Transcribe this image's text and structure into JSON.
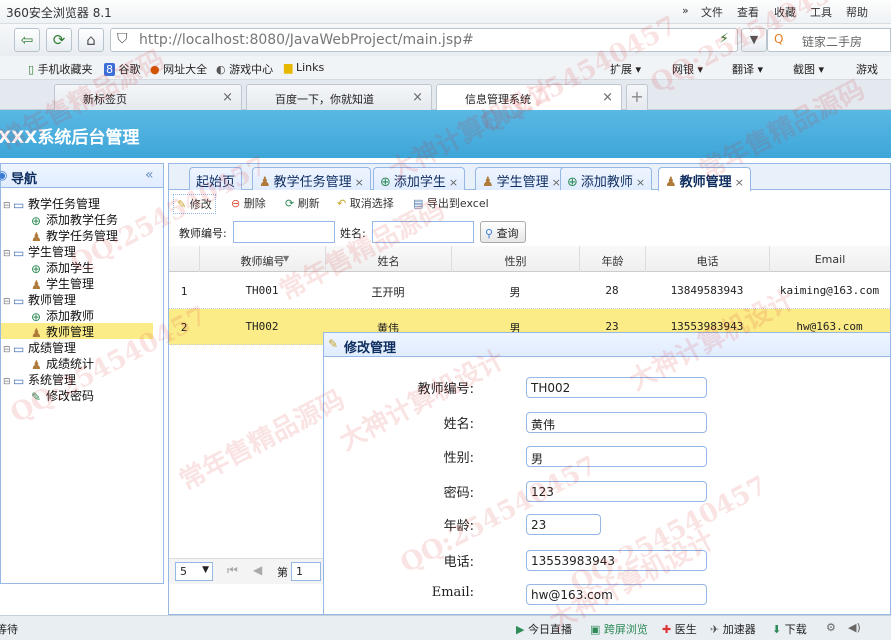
{
  "browser": {
    "title": "360安全浏览器 8.1",
    "menu": [
      "»",
      "文件",
      "查看",
      "收藏",
      "工具",
      "帮助"
    ],
    "url": "http://localhost:8080/JavaWebProject/main.jsp#",
    "search_placeholder": "链家二手房",
    "favorites": [
      "手机收藏夹",
      "谷歌",
      "网址大全",
      "游戏中心",
      "Links"
    ],
    "fav_right": [
      "扩展",
      "网银",
      "翻译",
      "截图",
      "游戏"
    ],
    "tabs": [
      {
        "label": "新标签页"
      },
      {
        "label": "百度一下，你就知道"
      },
      {
        "label": "信息管理系统"
      }
    ],
    "tab_close": "×",
    "new_tab": "+"
  },
  "app": {
    "title": "XXX系统后台管理"
  },
  "sidebar": {
    "title": "导航",
    "collapse": "«",
    "tree": [
      {
        "label": "教学任务管理",
        "level": 0
      },
      {
        "label": "添加教学任务",
        "level": 1,
        "icon": "add"
      },
      {
        "label": "教学任务管理",
        "level": 1,
        "icon": "user"
      },
      {
        "label": "学生管理",
        "level": 0
      },
      {
        "label": "添加学生",
        "level": 1,
        "icon": "add"
      },
      {
        "label": "学生管理",
        "level": 1,
        "icon": "user"
      },
      {
        "label": "教师管理",
        "level": 0
      },
      {
        "label": "添加教师",
        "level": 1,
        "icon": "add"
      },
      {
        "label": "教师管理",
        "level": 1,
        "icon": "user",
        "selected": true
      },
      {
        "label": "成绩管理",
        "level": 0
      },
      {
        "label": "成绩统计",
        "level": 1,
        "icon": "user"
      },
      {
        "label": "系统管理",
        "level": 0
      },
      {
        "label": "修改密码",
        "level": 1,
        "icon": "edit"
      }
    ]
  },
  "content_tabs": [
    {
      "label": "起始页",
      "closable": false
    },
    {
      "label": "教学任务管理",
      "closable": true
    },
    {
      "label": "添加学生",
      "closable": true
    },
    {
      "label": "学生管理",
      "closable": true
    },
    {
      "label": "添加教师",
      "closable": true
    },
    {
      "label": "教师管理",
      "closable": true,
      "active": true
    }
  ],
  "toolbar": {
    "edit": "修改",
    "delete": "删除",
    "refresh": "刷新",
    "cancel": "取消选择",
    "export": "导出到excel"
  },
  "filter": {
    "teacher_no_label": "教师编号:",
    "name_label": "姓名:",
    "query": "查询"
  },
  "grid": {
    "columns": [
      "教师编号",
      "姓名",
      "性别",
      "年龄",
      "电话",
      "Email"
    ],
    "rows": [
      {
        "n": "1",
        "cells": [
          "TH001",
          "王开明",
          "男",
          "28",
          "13849583943",
          "kaiming@163.com"
        ]
      },
      {
        "n": "2",
        "cells": [
          "TH002",
          "黄伟",
          "男",
          "23",
          "13553983943",
          "hw@163.com"
        ]
      }
    ]
  },
  "pager": {
    "page_size": "5",
    "page_label": "第",
    "page": "1"
  },
  "modal": {
    "title": "修改管理",
    "fields": [
      {
        "label": "教师编号:",
        "value": "TH002"
      },
      {
        "label": "姓名:",
        "value": "黄伟"
      },
      {
        "label": "性别:",
        "value": "男"
      },
      {
        "label": "密码:",
        "value": "123"
      },
      {
        "label": "年龄:",
        "value": "23"
      },
      {
        "label": "电话:",
        "value": "13553983943"
      },
      {
        "label": "Email:",
        "value": "hw@163.com"
      }
    ]
  },
  "status": {
    "left": "等待",
    "items": [
      "今日直播",
      "跨屏浏览",
      "医生",
      "加速器",
      "下载"
    ]
  },
  "watermarks": [
    "QQ:254540457",
    "常年售精品源码",
    "大神计算机设计"
  ]
}
